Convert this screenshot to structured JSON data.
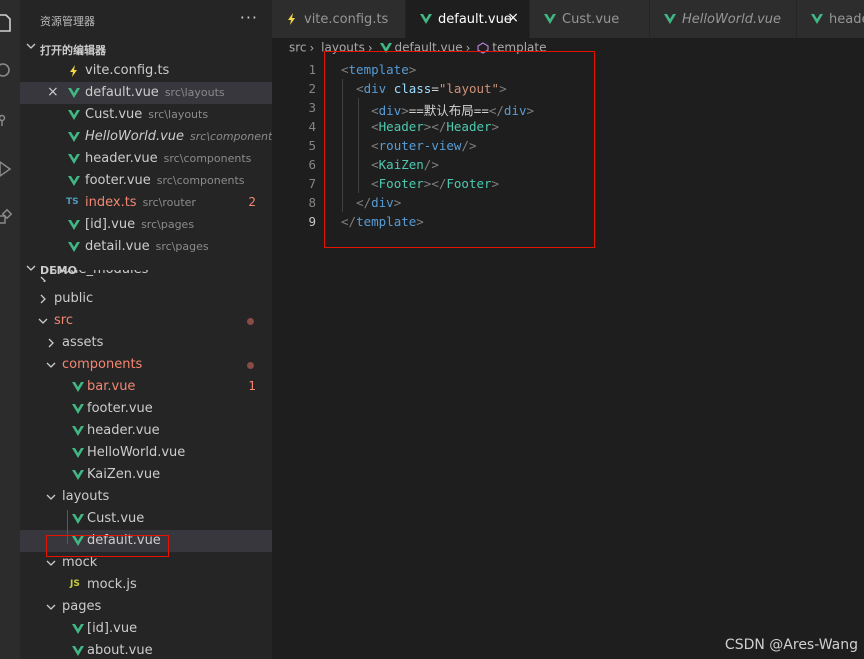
{
  "sidebar": {
    "title": "资源管理器",
    "more": "···",
    "open_editors": {
      "label": "打开的编辑器",
      "items": [
        {
          "name": "vite.config.ts",
          "path": "",
          "icon": "bolt-icon"
        },
        {
          "name": "default.vue",
          "path": "src\\layouts",
          "icon": "vue-icon",
          "close": "×"
        },
        {
          "name": "Cust.vue",
          "path": "src\\layouts",
          "icon": "vue-icon"
        },
        {
          "name": "HelloWorld.vue",
          "path": "src\\components",
          "icon": "vue-icon"
        },
        {
          "name": "header.vue",
          "path": "src\\components",
          "icon": "vue-icon"
        },
        {
          "name": "footer.vue",
          "path": "src\\components",
          "icon": "vue-icon"
        },
        {
          "name": "index.ts",
          "path": "src\\router",
          "icon": "TS",
          "badge": "2"
        },
        {
          "name": "[id].vue",
          "path": "src\\pages",
          "icon": "vue-icon"
        },
        {
          "name": "detail.vue",
          "path": "src\\pages",
          "icon": "vue-icon"
        }
      ]
    },
    "project": {
      "label": "DEMO",
      "items": [
        {
          "name": "node_modules"
        },
        {
          "name": "public"
        },
        {
          "name": "src"
        },
        {
          "name": "assets"
        },
        {
          "name": "components"
        },
        {
          "name": "bar.vue",
          "badge": "1"
        },
        {
          "name": "footer.vue"
        },
        {
          "name": "header.vue"
        },
        {
          "name": "HelloWorld.vue"
        },
        {
          "name": "KaiZen.vue"
        },
        {
          "name": "layouts"
        },
        {
          "name": "Cust.vue"
        },
        {
          "name": "default.vue"
        },
        {
          "name": "mock"
        },
        {
          "name": "mock.js",
          "icon": "JS"
        },
        {
          "name": "pages"
        },
        {
          "name": "[id].vue"
        },
        {
          "name": "about.vue"
        }
      ]
    }
  },
  "tabs": [
    {
      "label": "vite.config.ts"
    },
    {
      "label": "default.vue",
      "close": "×"
    },
    {
      "label": "Cust.vue"
    },
    {
      "label": "HelloWorld.vue"
    },
    {
      "label": "header.vue"
    }
  ],
  "breadcrumb": [
    "src",
    "layouts",
    "default.vue",
    "template"
  ],
  "editor": {
    "line_numbers": [
      "1",
      "2",
      "3",
      "4",
      "5",
      "6",
      "7",
      "8",
      "9"
    ],
    "lines": [
      [
        [
          "tg",
          "<"
        ],
        [
          "tn",
          "template"
        ],
        [
          "tg",
          ">"
        ]
      ],
      [
        [
          "tx",
          "  "
        ],
        [
          "tg",
          "<"
        ],
        [
          "tn",
          "div"
        ],
        [
          "tx",
          " "
        ],
        [
          "ta",
          "class"
        ],
        [
          "tx",
          "="
        ],
        [
          "ts",
          "\"layout\""
        ],
        [
          "tg",
          ">"
        ]
      ],
      [
        [
          "tx",
          "    "
        ],
        [
          "tg",
          "<"
        ],
        [
          "tn",
          "div"
        ],
        [
          "tg",
          ">"
        ],
        [
          "tx",
          "==默认布局=="
        ],
        [
          "tg",
          "</"
        ],
        [
          "tn",
          "div"
        ],
        [
          "tg",
          ">"
        ]
      ],
      [
        [
          "tx",
          "    "
        ],
        [
          "tg",
          "<"
        ],
        [
          "tc",
          "Header"
        ],
        [
          "tg",
          "></"
        ],
        [
          "tc",
          "Header"
        ],
        [
          "tg",
          ">"
        ]
      ],
      [
        [
          "tx",
          "    "
        ],
        [
          "tg",
          "<"
        ],
        [
          "tn",
          "router-view"
        ],
        [
          "tg",
          "/>"
        ]
      ],
      [
        [
          "tx",
          "    "
        ],
        [
          "tg",
          "<"
        ],
        [
          "tc",
          "KaiZen"
        ],
        [
          "tg",
          "/>"
        ]
      ],
      [
        [
          "tx",
          "    "
        ],
        [
          "tg",
          "<"
        ],
        [
          "tc",
          "Footer"
        ],
        [
          "tg",
          "></"
        ],
        [
          "tc",
          "Footer"
        ],
        [
          "tg",
          ">"
        ]
      ],
      [
        [
          "tx",
          "  "
        ],
        [
          "tg",
          "</"
        ],
        [
          "tn",
          "div"
        ],
        [
          "tg",
          ">"
        ]
      ],
      [
        [
          "tg",
          "</"
        ],
        [
          "tn",
          "template"
        ],
        [
          "tg",
          ">"
        ]
      ]
    ]
  },
  "watermark": "CSDN @Ares-Wang",
  "colors": {
    "vue_green": "#41b883",
    "error_red": "#f48771",
    "highlight_red": "#e51400"
  }
}
